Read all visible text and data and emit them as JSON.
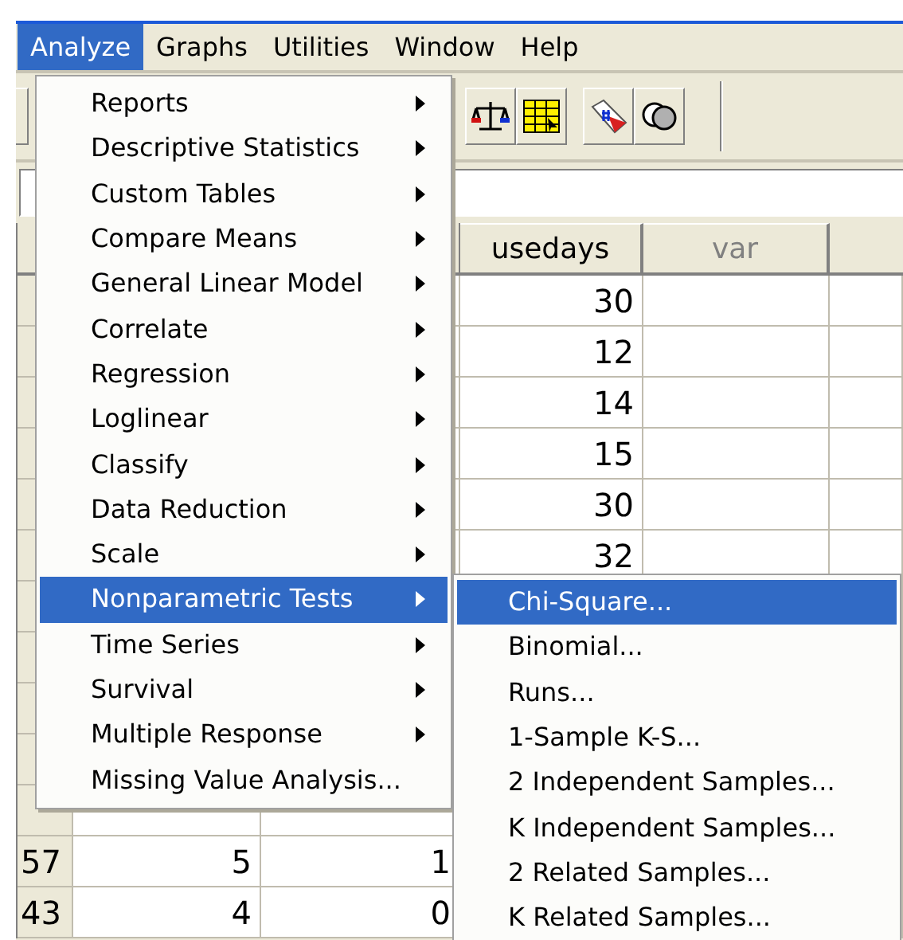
{
  "menu_bar": [
    {
      "label": "Analyze",
      "selected": true
    },
    {
      "label": "Graphs",
      "selected": false
    },
    {
      "label": "Utilities",
      "selected": false
    },
    {
      "label": "Window",
      "selected": false
    },
    {
      "label": "Help",
      "selected": false
    }
  ],
  "data_grid": {
    "columns": [
      {
        "label": "usedays",
        "kind": "variable"
      },
      {
        "label": "var",
        "kind": "empty"
      }
    ],
    "rows": [
      {
        "usedays": "30"
      },
      {
        "usedays": "12"
      },
      {
        "usedays": "14"
      },
      {
        "usedays": "15"
      },
      {
        "usedays": "30"
      },
      {
        "usedays": "32"
      },
      {},
      {},
      {},
      {},
      {},
      {
        "case_number": "57",
        "column_2": "5",
        "column_3": "1"
      },
      {
        "case_number": "43",
        "column_2": "4",
        "column_3": "0"
      }
    ]
  },
  "analyze_menu": [
    {
      "label": "Reports",
      "selected": false,
      "submenu": true
    },
    {
      "label": "Descriptive Statistics",
      "selected": false,
      "submenu": true
    },
    {
      "label": "Custom Tables",
      "selected": false,
      "submenu": true
    },
    {
      "label": "Compare Means",
      "selected": false,
      "submenu": true
    },
    {
      "label": "General Linear Model",
      "selected": false,
      "submenu": true
    },
    {
      "label": "Correlate",
      "selected": false,
      "submenu": true
    },
    {
      "label": "Regression",
      "selected": false,
      "submenu": true
    },
    {
      "label": "Loglinear",
      "selected": false,
      "submenu": true
    },
    {
      "label": "Classify",
      "selected": false,
      "submenu": true
    },
    {
      "label": "Data Reduction",
      "selected": false,
      "submenu": true
    },
    {
      "label": "Scale",
      "selected": false,
      "submenu": true
    },
    {
      "label": "Nonparametric Tests",
      "selected": true,
      "submenu": true
    },
    {
      "label": "Time Series",
      "selected": false,
      "submenu": true
    },
    {
      "label": "Survival",
      "selected": false,
      "submenu": true
    },
    {
      "label": "Multiple Response",
      "selected": false,
      "submenu": true
    },
    {
      "label": "Missing Value Analysis...",
      "selected": false,
      "submenu": false
    }
  ],
  "nonparametric_submenu": [
    {
      "label": "Chi-Square...",
      "selected": true
    },
    {
      "label": "Binomial...",
      "selected": false
    },
    {
      "label": "Runs...",
      "selected": false
    },
    {
      "label": "1-Sample K-S...",
      "selected": false
    },
    {
      "label": "2 Independent Samples...",
      "selected": false
    },
    {
      "label": "K Independent Samples...",
      "selected": false
    },
    {
      "label": "2 Related Samples...",
      "selected": false
    },
    {
      "label": "K Related Samples...",
      "selected": false
    }
  ]
}
